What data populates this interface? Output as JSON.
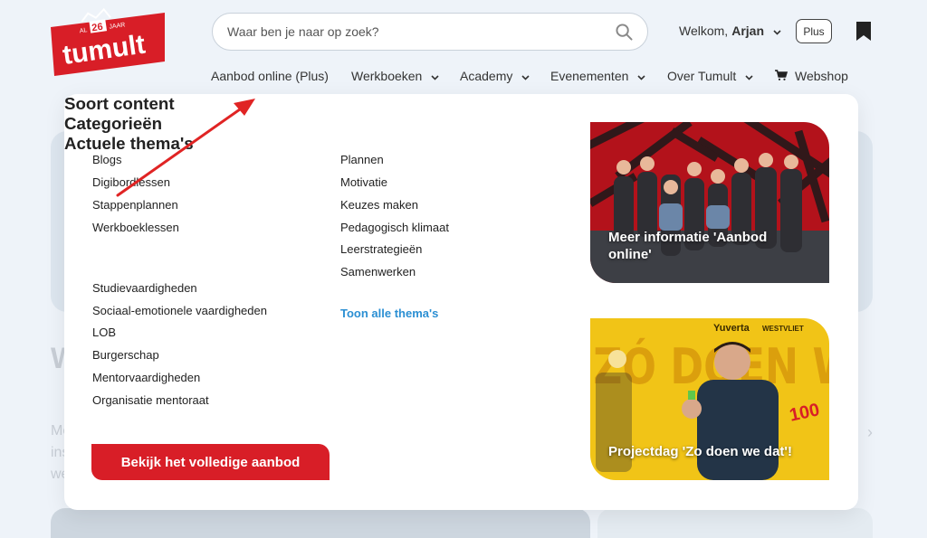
{
  "logo": {
    "brand": "tumult",
    "badge_prefix": "AL",
    "badge_number": "26",
    "badge_suffix": "JAAR"
  },
  "search": {
    "placeholder": "Waar ben je naar op zoek?",
    "icon": "search-icon"
  },
  "account": {
    "greeting": "Welkom,",
    "user_name": "Arjan",
    "plan_badge": "Plus"
  },
  "nav": {
    "items": [
      {
        "label": "Aanbod online (Plus)",
        "has_chevron": false
      },
      {
        "label": "Werkboeken",
        "has_chevron": true
      },
      {
        "label": "Academy",
        "has_chevron": true
      },
      {
        "label": "Evenementen",
        "has_chevron": true
      },
      {
        "label": "Over Tumult",
        "has_chevron": true
      },
      {
        "label": "Webshop",
        "icon": "cart-icon"
      }
    ]
  },
  "dropdown": {
    "content_types": {
      "heading": "Soort content",
      "items": [
        "Blogs",
        "Digibordlessen",
        "Stappenplannen",
        "Werkboeklessen"
      ]
    },
    "categories": {
      "heading": "Categorieën",
      "items": [
        "Studievaardigheden",
        "Sociaal-emotionele vaardigheden",
        "LOB",
        "Burgerschap",
        "Mentorvaardigheden",
        "Organisatie mentoraat"
      ]
    },
    "themes": {
      "heading": "Actuele thema's",
      "items": [
        "Plannen",
        "Motivatie",
        "Keuzes maken",
        "Pedagogisch klimaat",
        "Leerstrategieën",
        "Samenwerken"
      ],
      "show_all": "Toon alle thema's"
    },
    "cta_label": "Bekijk het volledige aanbod",
    "cards": [
      {
        "caption": "Meer informatie 'Aanbod online'"
      },
      {
        "caption": "Projectdag 'Zo doen we dat'!",
        "poster_brand": "Yuverta",
        "poster_sub": "WESTVLIET",
        "poster_text": "ZÓ DOEN WE DAT!",
        "poster_number": "100"
      }
    ]
  },
  "background": {
    "partial_letter": "W",
    "partial_lines": [
      "Me",
      "ins",
      "we"
    ]
  },
  "colors": {
    "brand_red": "#d81e27",
    "link_blue": "#2b8fd3",
    "page_bg": "#eef3f9",
    "annotation_arrow": "#e02424"
  }
}
